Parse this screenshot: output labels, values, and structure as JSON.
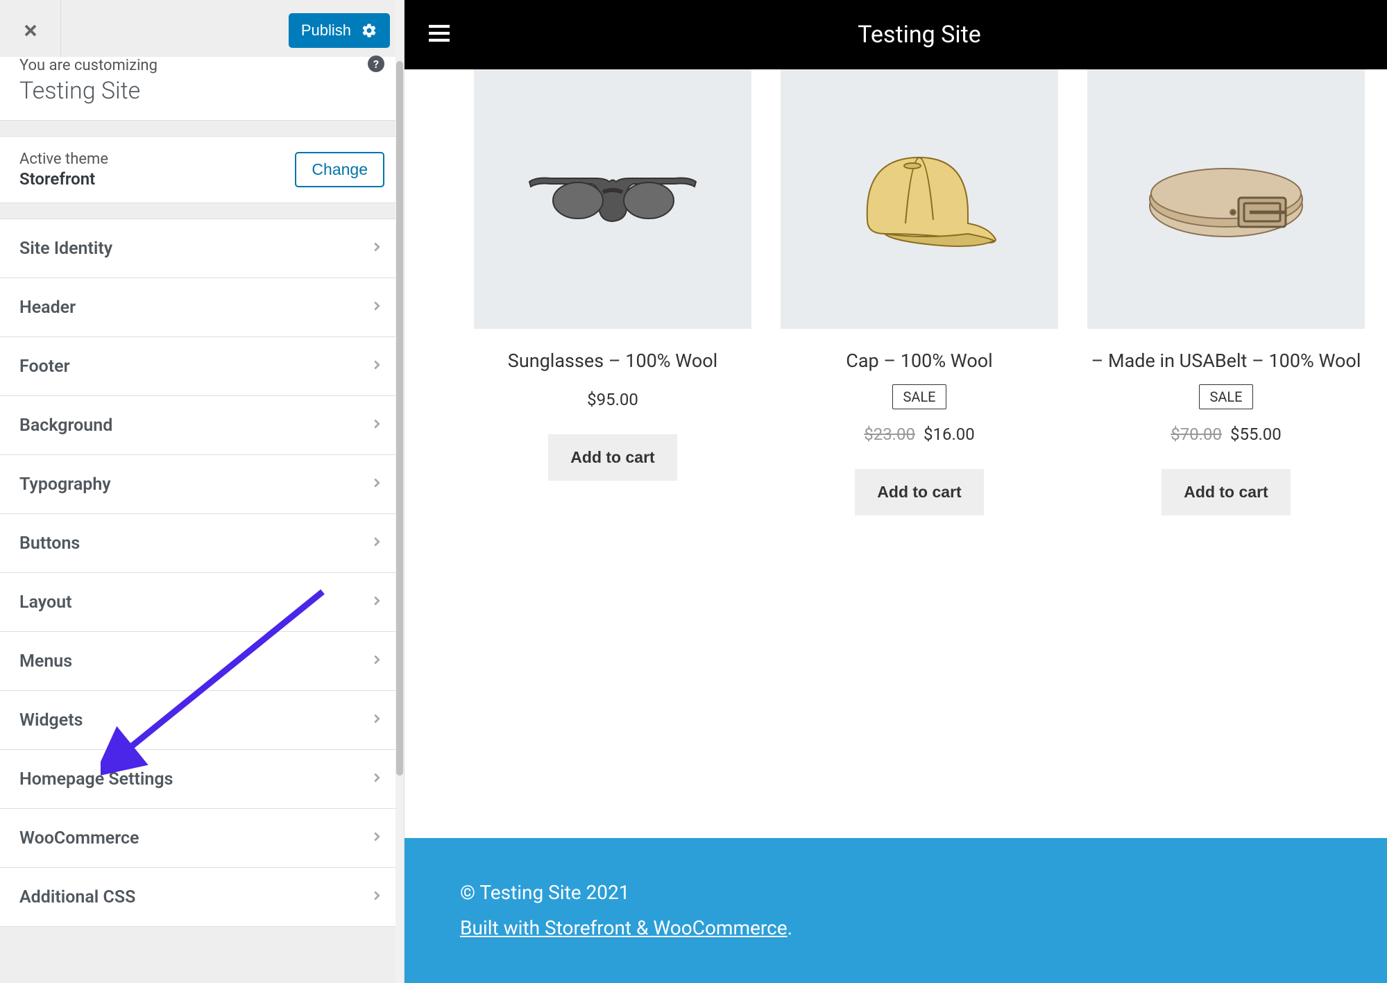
{
  "sidebar": {
    "publish_label": "Publish",
    "customizing_label": "You are customizing",
    "site_title": "Testing Site",
    "theme_label": "Active theme",
    "theme_name": "Storefront",
    "change_label": "Change",
    "menu_items": [
      "Site Identity",
      "Header",
      "Footer",
      "Background",
      "Typography",
      "Buttons",
      "Layout",
      "Menus",
      "Widgets",
      "Homepage Settings",
      "WooCommerce",
      "Additional CSS"
    ]
  },
  "preview": {
    "site_title": "Testing Site",
    "sale_label": "SALE",
    "add_to_cart": "Add to cart",
    "products": [
      {
        "title": "Sunglasses – 100% Wool",
        "price": "$95.00",
        "old_price": "",
        "sale": false
      },
      {
        "title": "Cap – 100% Wool",
        "price": "$16.00",
        "old_price": "$23.00",
        "sale": true
      },
      {
        "title": "– Made in USABelt – 100% Wool",
        "price": "$55.00",
        "old_price": "$70.00",
        "sale": true
      }
    ],
    "footer": {
      "copyright": "© Testing Site 2021",
      "built": "Built with Storefront & WooCommerce",
      "period": "."
    }
  }
}
